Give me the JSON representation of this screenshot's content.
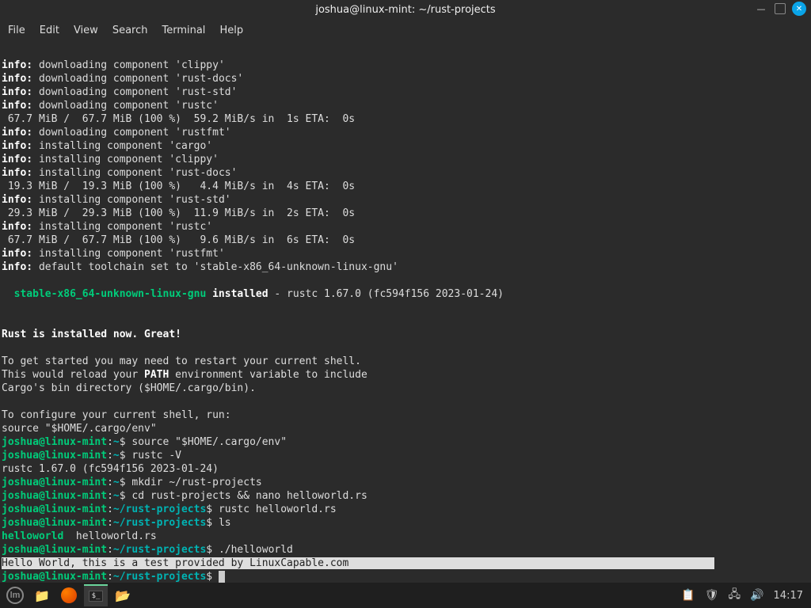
{
  "window": {
    "title": "joshua@linux-mint: ~/rust-projects"
  },
  "menubar": {
    "file": "File",
    "edit": "Edit",
    "view": "View",
    "search": "Search",
    "terminal": "Terminal",
    "help": "Help"
  },
  "term": {
    "l1a": "info:",
    "l1b": " downloading component 'clippy'",
    "l2a": "info:",
    "l2b": " downloading component 'rust-docs'",
    "l3a": "info:",
    "l3b": " downloading component 'rust-std'",
    "l4a": "info:",
    "l4b": " downloading component 'rustc'",
    "l5": " 67.7 MiB /  67.7 MiB (100 %)  59.2 MiB/s in  1s ETA:  0s",
    "l6a": "info:",
    "l6b": " downloading component 'rustfmt'",
    "l7a": "info:",
    "l7b": " installing component 'cargo'",
    "l8a": "info:",
    "l8b": " installing component 'clippy'",
    "l9a": "info:",
    "l9b": " installing component 'rust-docs'",
    "l10": " 19.3 MiB /  19.3 MiB (100 %)   4.4 MiB/s in  4s ETA:  0s",
    "l11a": "info:",
    "l11b": " installing component 'rust-std'",
    "l12": " 29.3 MiB /  29.3 MiB (100 %)  11.9 MiB/s in  2s ETA:  0s",
    "l13a": "info:",
    "l13b": " installing component 'rustc'",
    "l14": " 67.7 MiB /  67.7 MiB (100 %)   9.6 MiB/s in  6s ETA:  0s",
    "l15a": "info:",
    "l15b": " installing component 'rustfmt'",
    "l16a": "info:",
    "l16b": " default toolchain set to 'stable-x86_64-unknown-linux-gnu'",
    "l18a": "  stable-x86_64-unknown-linux-gnu",
    "l18b": " installed",
    "l18c": " - rustc 1.67.0 (fc594f156 2023-01-24)",
    "l21": "Rust is installed now. Great!",
    "l23": "To get started you may need to restart your current shell.",
    "l24a": "This would reload your ",
    "l24b": "PATH",
    "l24c": " environment variable to include",
    "l25": "Cargo's bin directory ($HOME/.cargo/bin).",
    "l27": "To configure your current shell, run:",
    "l28": "source \"$HOME/.cargo/env\"",
    "p_user": "joshua@linux-mint",
    "p_sep1": ":",
    "p_home": "~",
    "p_dol": "$",
    "p_proj": "~/rust-projects",
    "c1": " source \"$HOME/.cargo/env\"",
    "c2": " rustc -V",
    "r2": "rustc 1.67.0 (fc594f156 2023-01-24)",
    "c3": " mkdir ~/rust-projects",
    "c4": " cd rust-projects && nano helloworld.rs",
    "c5": " rustc helloworld.rs",
    "c6": " ls",
    "ls1": "helloworld",
    "ls2": "  helloworld.rs",
    "c7": " ./helloworld",
    "out": "Hello World, this is a test provided by LinuxCapable.com",
    "outpad": "                                                           ",
    "last": " "
  },
  "taskbar": {
    "clock": "14:17"
  }
}
